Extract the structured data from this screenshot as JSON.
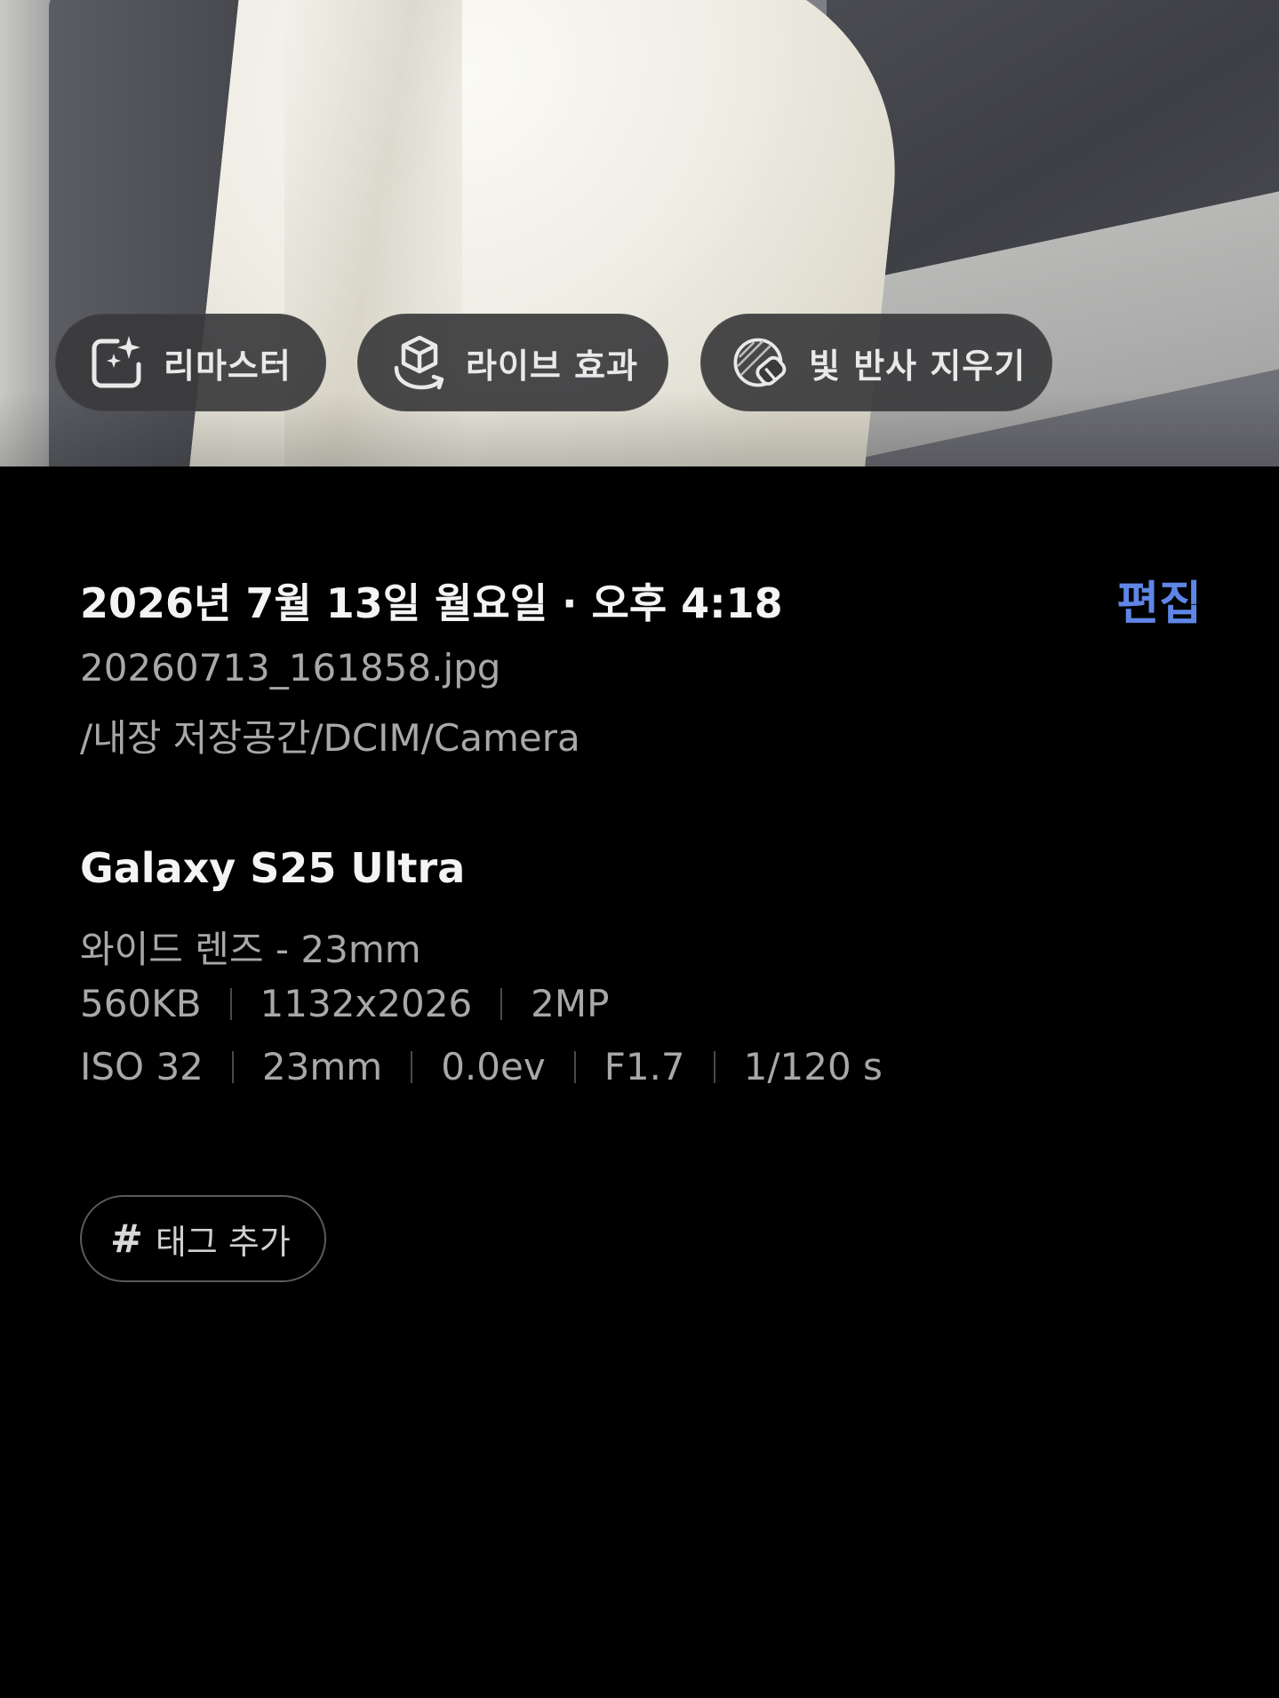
{
  "photo": {
    "actions": [
      {
        "id": "remaster",
        "label": "리마스터",
        "icon": "remaster-sparkle-icon"
      },
      {
        "id": "live",
        "label": "라이브 효과",
        "icon": "cube-rotate-icon"
      },
      {
        "id": "reflection",
        "label": "빛 반사 지우기",
        "icon": "eraser-reflection-icon"
      }
    ]
  },
  "details": {
    "date": "2026년 7월 13일 월요일 · 오후 4:18",
    "edit_label": "편집",
    "filename": "20260713_161858.jpg",
    "path": "/내장 저장공간/DCIM/Camera",
    "device": "Galaxy S25 Ultra",
    "lens": "와이드 렌즈 - 23mm",
    "file_meta": [
      "560KB",
      "1132x2026",
      "2MP"
    ],
    "exif": [
      "ISO 32",
      "23mm",
      "0.0ev",
      "F1.7",
      "1/120 s"
    ],
    "tag_label": "태그 추가",
    "tag_icon": "#"
  },
  "colors": {
    "background": "#000000",
    "accent": "#5f86e6",
    "chip_bg": "#3a3a3c",
    "primary_text": "#f4f4f5",
    "secondary_text": "#a8a8ab"
  }
}
